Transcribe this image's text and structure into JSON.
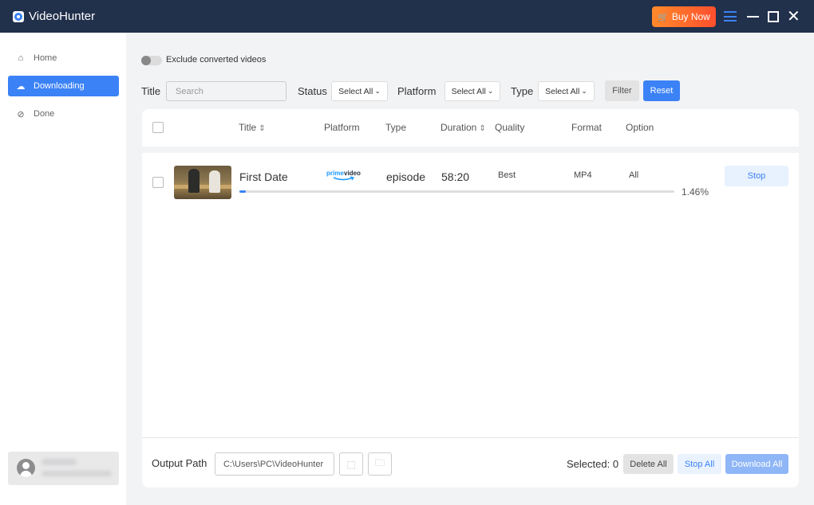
{
  "app": {
    "name": "VideoHunter",
    "buy_now_label": "Buy Now",
    "accent_color": "#3b82f6",
    "titlebar_color": "#21304b"
  },
  "sidebar": {
    "items": [
      {
        "label": "Home",
        "icon": "home-icon",
        "active": false
      },
      {
        "label": "Downloading",
        "icon": "cloud-download-icon",
        "active": true
      },
      {
        "label": "Done",
        "icon": "check-circle-icon",
        "active": false
      }
    ]
  },
  "filters": {
    "exclude_converted_label": "Exclude converted videos",
    "exclude_converted_on": false,
    "title_label": "Title",
    "search_placeholder": "Search",
    "status_label": "Status",
    "status_value": "Select All",
    "platform_label": "Platform",
    "platform_value": "Select All",
    "type_label": "Type",
    "type_value": "Select All",
    "filter_button": "Filter",
    "reset_button": "Reset"
  },
  "table": {
    "columns": [
      "Title",
      "Platform",
      "Type",
      "Duration",
      "Quality",
      "Format",
      "Option"
    ],
    "rows": [
      {
        "title": "First Date",
        "platform": "prime video",
        "type": "episode",
        "duration": "58:20",
        "quality": "Best",
        "format": "MP4",
        "option": "All",
        "progress_percent": 1.46,
        "progress_label": "1.46%",
        "action_label": "Stop"
      }
    ]
  },
  "footer": {
    "output_path_label": "Output Path",
    "output_path_value": "C:\\Users\\PC\\VideoHunter",
    "selected_label": "Selected: 0",
    "delete_all_label": "Delete All",
    "stop_all_label": "Stop All",
    "download_all_label": "Download All"
  }
}
